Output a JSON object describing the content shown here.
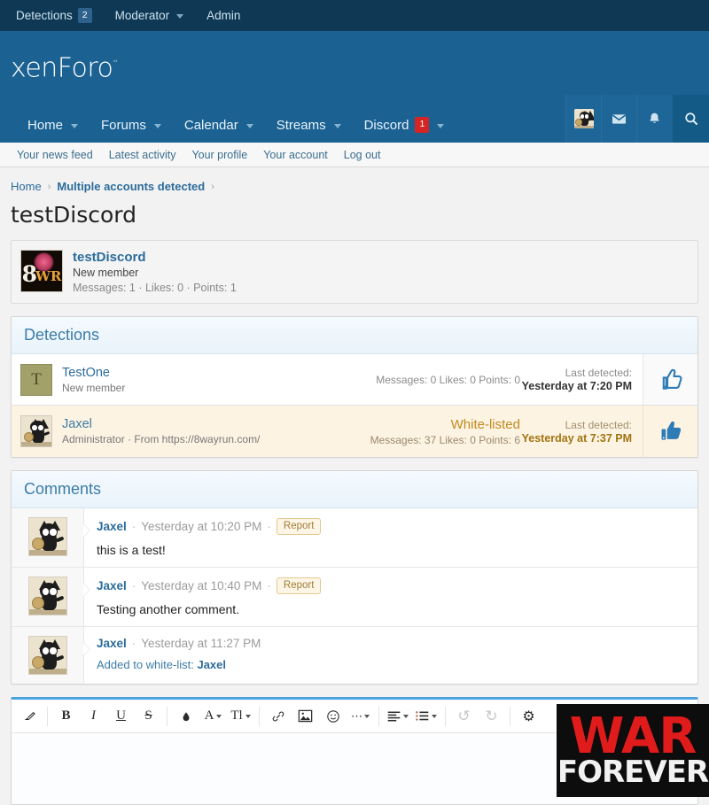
{
  "adminbar": {
    "items": [
      {
        "label": "Detections",
        "badge": "2",
        "has_caret": false
      },
      {
        "label": "Moderator",
        "badge": "",
        "has_caret": true
      },
      {
        "label": "Admin",
        "badge": "",
        "has_caret": false
      }
    ]
  },
  "header": {
    "logo": "xenForo",
    "logo_tm": "™"
  },
  "nav": {
    "items": [
      {
        "label": "Home",
        "caret": true,
        "badge": ""
      },
      {
        "label": "Forums",
        "caret": true,
        "badge": ""
      },
      {
        "label": "Calendar",
        "caret": true,
        "badge": ""
      },
      {
        "label": "Streams",
        "caret": true,
        "badge": ""
      },
      {
        "label": "Discord",
        "caret": true,
        "badge": "1"
      }
    ],
    "icons": [
      "user-avatar-icon",
      "inbox-icon",
      "bell-icon",
      "search-icon"
    ]
  },
  "subnav": {
    "items": [
      "Your news feed",
      "Latest activity",
      "Your profile",
      "Your account",
      "Log out"
    ]
  },
  "breadcrumb": {
    "home": "Home",
    "current": "Multiple accounts detected",
    "sep": "›"
  },
  "page": {
    "title": "testDiscord"
  },
  "member_card": {
    "name": "testDiscord",
    "title": "New member",
    "stats": "Messages: 1 · Likes: 0 · Points: 1",
    "avatar": "8wr-avatar"
  },
  "detections": {
    "heading": "Detections",
    "rows": [
      {
        "avatar_letter": "T",
        "avatar_type": "letter-avatar",
        "name": "TestOne",
        "subtitle": "New member",
        "flag": "",
        "stats": "Messages: 0  Likes: 0  Points: 0",
        "time_label": "Last detected:",
        "time_value": "Yesterday at 7:20 PM",
        "action_icon": "thumbs-up-outline-icon",
        "highlight": false
      },
      {
        "avatar_letter": "",
        "avatar_type": "cat-avatar",
        "name": "Jaxel",
        "subtitle": "Administrator · From https://8wayrun.com/",
        "flag": "White-listed",
        "stats": "Messages: 37  Likes: 0  Points: 6",
        "time_label": "Last detected:",
        "time_value": "Yesterday at 7:37 PM",
        "action_icon": "thumbs-up-filled-icon",
        "highlight": true
      }
    ]
  },
  "comments": {
    "heading": "Comments",
    "items": [
      {
        "user": "Jaxel",
        "dot": "·",
        "time": "Yesterday at 10:20 PM",
        "dot2": "·",
        "report_label": "Report",
        "has_report": true,
        "text": "this is a test!",
        "whitelist_text": "",
        "whitelist_user": ""
      },
      {
        "user": "Jaxel",
        "dot": "·",
        "time": "Yesterday at 10:40 PM",
        "dot2": "·",
        "report_label": "Report",
        "has_report": true,
        "text": "Testing another comment.",
        "whitelist_text": "",
        "whitelist_user": ""
      },
      {
        "user": "Jaxel",
        "dot": "·",
        "time": "Yesterday at 11:27 PM",
        "dot2": "",
        "report_label": "",
        "has_report": false,
        "text": "",
        "whitelist_text": "Added to white-list:",
        "whitelist_user": "Jaxel"
      }
    ]
  },
  "editor": {
    "buttons": [
      {
        "name": "remove-formatting-icon",
        "glyph": "◥",
        "caret": false,
        "dim": false
      },
      {
        "name": "bold-icon",
        "glyph": "B",
        "caret": false,
        "dim": false
      },
      {
        "name": "italic-icon",
        "glyph": "I",
        "caret": false,
        "dim": false
      },
      {
        "name": "underline-icon",
        "glyph": "U",
        "caret": false,
        "dim": false
      },
      {
        "name": "strikethrough-icon",
        "glyph": "S",
        "caret": false,
        "dim": false
      },
      {
        "name": "text-color-icon",
        "glyph": "◆",
        "caret": false,
        "dim": false
      },
      {
        "name": "font-family-icon",
        "glyph": "A",
        "caret": true,
        "dim": false
      },
      {
        "name": "font-size-icon",
        "glyph": "Tl",
        "caret": true,
        "dim": false
      },
      {
        "name": "link-icon",
        "glyph": "⚭",
        "caret": false,
        "dim": false
      },
      {
        "name": "image-icon",
        "glyph": "⛰",
        "caret": false,
        "dim": false
      },
      {
        "name": "smilie-icon",
        "glyph": "☺",
        "caret": false,
        "dim": false
      },
      {
        "name": "more-options-icon",
        "glyph": "⋯",
        "caret": true,
        "dim": false
      },
      {
        "name": "align-icon",
        "glyph": "☰",
        "caret": true,
        "dim": false
      },
      {
        "name": "list-icon",
        "glyph": "☰",
        "caret": true,
        "dim": false
      },
      {
        "name": "undo-icon",
        "glyph": "↺",
        "caret": false,
        "dim": true
      },
      {
        "name": "redo-icon",
        "glyph": "↻",
        "caret": false,
        "dim": true
      },
      {
        "name": "settings-gear-icon",
        "glyph": "⚙",
        "caret": false,
        "dim": false
      }
    ],
    "content": ""
  },
  "watermark": {
    "line1": "WAR",
    "line2": "FOREVER"
  },
  "colors": {
    "adminbar": "#0f3854",
    "header": "#1b6293",
    "accent": "#2b6c9b",
    "badge_red": "#d42424",
    "whitelist_row": "#fdf3e3",
    "whitelist_text": "#c08a1e",
    "editor_top": "#4ba3dd"
  }
}
